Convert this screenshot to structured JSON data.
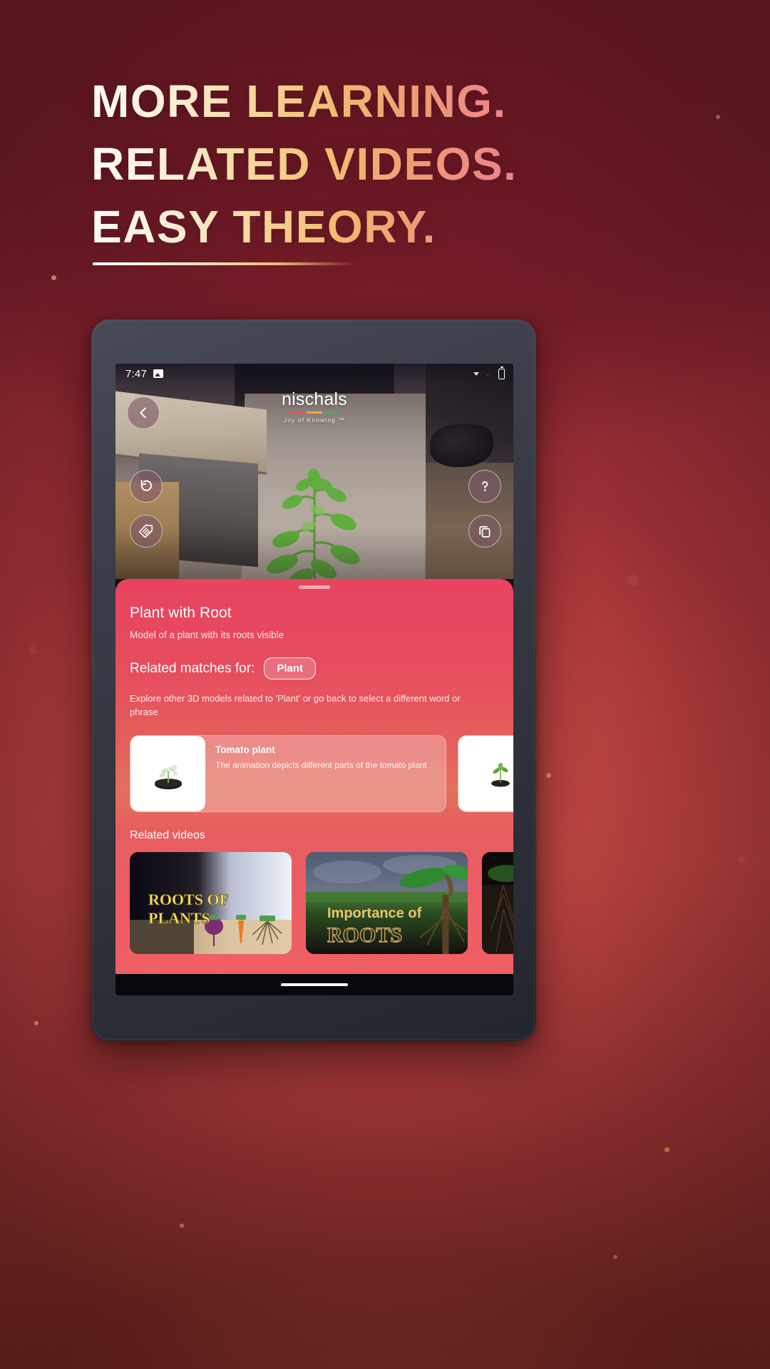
{
  "promo": {
    "headline_lines": [
      "MORE LEARNING.",
      "RELATED VIDEOS.",
      "EASY THEORY."
    ],
    "accent_colors": {
      "bg_deep": "#72202e",
      "bg_mid": "#b4453c",
      "bg_warm": "#6a2a1f",
      "sheet_pink": "#e8435f",
      "sheet_orange": "#e2705c"
    }
  },
  "device": {
    "statusbar": {
      "time": "7:47",
      "left_icons": [
        "image-icon"
      ],
      "right_icons": [
        "caret-icon",
        "wifi-icon",
        "battery-icon"
      ]
    },
    "navbar": {
      "gesture_pill": "home-indicator"
    }
  },
  "ar": {
    "logo_name": "nischals",
    "logo_tagline": "Joy of Knowing ™",
    "logo_bar_colors": [
      "#e05a4e",
      "#f0a93a",
      "#4fa86a"
    ],
    "buttons_left": [
      {
        "name": "back-button",
        "icon": "chevron-left-icon",
        "label": "Back"
      },
      {
        "name": "reset-button",
        "icon": "rotate-ccw-icon",
        "label": "Reset"
      },
      {
        "name": "label-button",
        "icon": "tag-lines-icon",
        "label": "Labels"
      }
    ],
    "buttons_right": [
      {
        "name": "help-button",
        "icon": "question-mark-icon",
        "label": "Help"
      },
      {
        "name": "duplicate-button",
        "icon": "copy-icon",
        "label": "Duplicate"
      }
    ]
  },
  "sheet": {
    "model_title": "Plant with Root",
    "model_subtitle": "Model of a plant with its roots visible",
    "matches_label": "Related matches for:",
    "matches_chip": "Plant",
    "explore_text": "Explore other 3D models related to 'Plant' or go back to select a different word or phrase",
    "match_cards": [
      {
        "title": "Tomato plant",
        "description": "The animation depicts different parts of the tomato plant",
        "thumb": "tomato-seedling-thumbnail"
      },
      {
        "title": "",
        "description": "",
        "thumb": "plant-sprout-thumbnail"
      }
    ],
    "related_videos_title": "Related videos",
    "related_videos": [
      {
        "caption_line1": "ROOTS OF",
        "caption_line2": "PLANTS",
        "thumb": "roots-of-plants-thumbnail"
      },
      {
        "caption_line1": "Importance of",
        "caption_line2": "ROOTS",
        "thumb": "importance-of-roots-thumbnail"
      },
      {
        "caption_line1": "",
        "caption_line2": "",
        "thumb": "soil-roots-thumbnail"
      }
    ],
    "enrich_title": "Enrich Your Learning",
    "enrich_cards": [
      {
        "thumb": "enrich-card-one"
      },
      {
        "thumb": "enrich-card-two"
      }
    ]
  }
}
